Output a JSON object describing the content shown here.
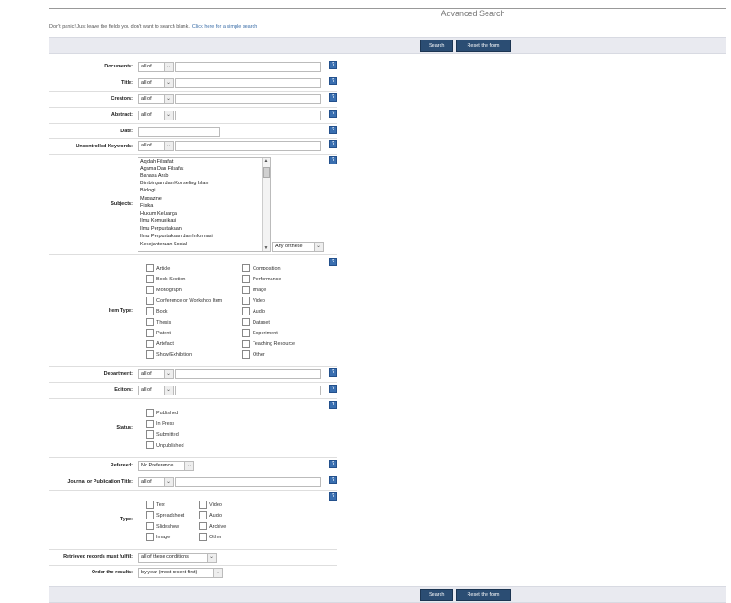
{
  "page": {
    "title": "Advanced Search",
    "intro": "Don't panic! Just leave the fields you don't want to search blank.",
    "simple_link": "Click here for a simple search"
  },
  "buttons": {
    "search": "Search",
    "reset": "Reset the form"
  },
  "fields": {
    "documents": {
      "label": "Documents:",
      "mode": "all of"
    },
    "title": {
      "label": "Title:",
      "mode": "all of"
    },
    "creators": {
      "label": "Creators:",
      "mode": "all of"
    },
    "abstract": {
      "label": "Abstract:",
      "mode": "all of"
    },
    "date": {
      "label": "Date:"
    },
    "keywords": {
      "label": "Uncontrolled Keywords:",
      "mode": "all of"
    },
    "subjects": {
      "label": "Subjects:",
      "options": [
        "Aqidah Filsafat",
        "Agama Dan Filsafat",
        "Bahasa Arab",
        "Bimbingan dan Konseling Islam",
        "Biologi",
        "Magazine",
        "Fisika",
        "Hukum Keluarga",
        "Ilmu Komunikasi",
        "Ilmu Perpustakaan",
        "Ilmu Perpustakaan dan Informasi",
        "Kesejahteraan Sosial"
      ],
      "match": "Any of these"
    },
    "item_type": {
      "label": "Item Type:",
      "col1": [
        "Article",
        "Book Section",
        "Monograph",
        "Conference or Workshop Item",
        "Book",
        "Thesis",
        "Patent",
        "Artefact",
        "Show/Exhibition"
      ],
      "col2": [
        "Composition",
        "Performance",
        "Image",
        "Video",
        "Audio",
        "Dataset",
        "Experiment",
        "Teaching Resource",
        "Other"
      ]
    },
    "department": {
      "label": "Department:",
      "mode": "all of"
    },
    "editors": {
      "label": "Editors:",
      "mode": "all of"
    },
    "status": {
      "label": "Status:",
      "options": [
        "Published",
        "In Press",
        "Submitted",
        "Unpublished"
      ]
    },
    "refereed": {
      "label": "Refereed:",
      "value": "No Preference"
    },
    "journal": {
      "label": "Journal or Publication Title:",
      "mode": "all of"
    },
    "type": {
      "label": "Type:",
      "col1": [
        "Text",
        "Spreadsheet",
        "Slideshow",
        "Image"
      ],
      "col2": [
        "Video",
        "Audio",
        "Archive",
        "Other"
      ]
    },
    "retrieved": {
      "label": "Retrieved records must fulfill:",
      "value": "all of these conditions"
    },
    "order": {
      "label": "Order the results:",
      "value": "by year (most recent first)"
    }
  },
  "icons": {
    "help": "help-icon",
    "dropdown": "chevron-down-icon"
  },
  "colors": {
    "button": "#2b4d73",
    "help": "#3a6fb0",
    "bar": "#e9eaf0",
    "link": "#3b6ea8"
  }
}
